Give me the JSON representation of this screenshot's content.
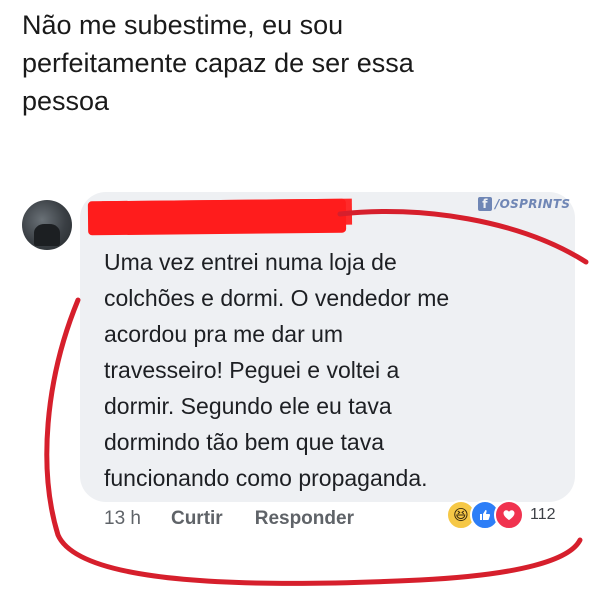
{
  "headline": {
    "lines": [
      "Não me subestime, eu sou",
      "perfeitamente capaz de ser essa",
      "pessoa"
    ]
  },
  "watermark": {
    "icon_letter": "f",
    "text": "/OSPRINTS"
  },
  "comment": {
    "lines": [
      "Uma vez entrei numa loja de",
      "colchões e dormi. O vendedor me",
      "acordou pra me dar um",
      "travesseiro! Peguei e voltei a",
      "dormir. Segundo ele eu tava",
      "dormindo tão bem que tava",
      "funcionando como propaganda."
    ]
  },
  "actions": {
    "time": "13 h",
    "like_label": "Curtir",
    "reply_label": "Responder"
  },
  "reactions": {
    "icons": [
      "haha-icon",
      "like-icon",
      "love-icon"
    ],
    "count": "112"
  },
  "colors": {
    "bubble": "#eef0f3",
    "redaction": "#ff1c1c",
    "marker": "#d61f2c",
    "watermark": "#6f86b5"
  }
}
